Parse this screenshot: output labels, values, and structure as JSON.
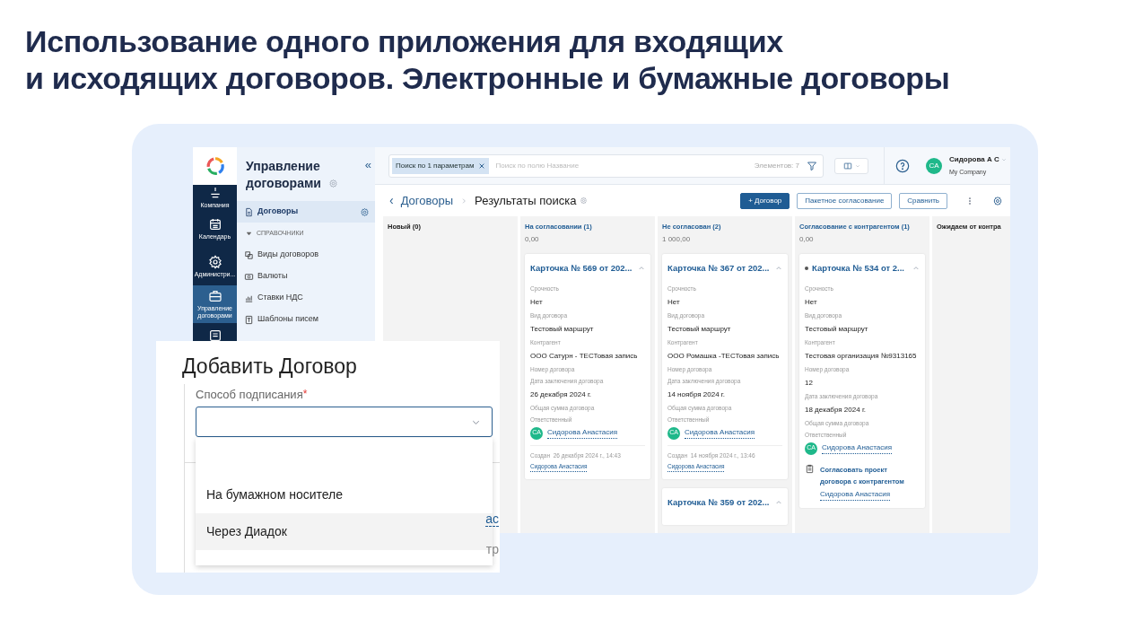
{
  "heading": [
    "Использование одного приложения для входящих",
    "и исходящих договоров. Электронные и бумажные договоры"
  ],
  "app": {
    "rail": [
      {
        "kind": "company",
        "label": "Компания",
        "selected": false
      },
      {
        "kind": "calendar",
        "label": "Календарь",
        "selected": false
      },
      {
        "kind": "admin",
        "label": "Администри...",
        "selected": false
      },
      {
        "kind": "contracts",
        "label": "Управление договорами",
        "selected": true
      },
      {
        "kind": "list",
        "selected": false
      }
    ],
    "sidebar": {
      "title": "Управление договорами",
      "items": [
        {
          "kind": "link",
          "label": "Договоры",
          "selected": true
        },
        {
          "kind": "section",
          "label": "СПРАВОЧНИКИ",
          "expanded": true,
          "children": [
            {
              "kind": "link",
              "label": "Виды договоров",
              "selected": false
            },
            {
              "kind": "link",
              "label": "Валюты",
              "selected": false
            },
            {
              "kind": "link",
              "label": "Ставки НДС",
              "selected": false
            },
            {
              "kind": "link",
              "label": "Шаблоны писем",
              "selected": false
            }
          ]
        }
      ],
      "collapse": "«"
    },
    "search": {
      "chip": "Поиск по 1 параметрам",
      "placeholder": "Поиск по полю Название",
      "count": "Элементов: 7"
    },
    "user": {
      "initials": "CA",
      "name": "Сидорова А С",
      "company": "My Company"
    },
    "back": "‹",
    "breadcrumb": [
      "Договоры",
      "Результаты поиска"
    ],
    "buttons": [
      {
        "kind": "primary",
        "label": "+ Договор"
      },
      {
        "kind": "outline",
        "label": "Пакетное согласование"
      },
      {
        "kind": "outline",
        "label": "Сравнить"
      }
    ],
    "columns": [
      {
        "title": "Новый (0)"
      },
      {
        "title": "На согласовании (1)",
        "sum": "0,00",
        "cards": [
          {
            "title": "Карточка № 569 от 202...",
            "dot": false,
            "fields": [
              {
                "label": "Срочность",
                "value": "Нет"
              },
              {
                "label": "Вид договора",
                "value": "Тестовый маршрут"
              },
              {
                "label": "Контрагент",
                "value": "ООО Сатурн - ТЕСТовая запись"
              },
              {
                "label": "Номер договора"
              },
              {
                "label": "Дата заключения договора",
                "value": "26 декабря 2024 г."
              },
              {
                "label": "Общая сумма договора"
              }
            ],
            "responsible_label": "Ответственный",
            "responsible": {
              "initials": "CA",
              "name": "Сидорова Анастасия"
            },
            "created": {
              "text": "Создан  26 декабря 2024 г., 14:43",
              "author": "Сидорова Анастасия"
            }
          }
        ]
      },
      {
        "title": "Не согласован (2)",
        "sum": "1 000,00",
        "cards": [
          {
            "title": "Карточка № 367 от 202...",
            "dot": false,
            "fields": [
              {
                "label": "Срочность",
                "value": "Нет"
              },
              {
                "label": "Вид договора",
                "value": "Тестовый маршрут"
              },
              {
                "label": "Контрагент",
                "value": "ООО Ромашка -ТЕСТовая запись"
              },
              {
                "label": "Номер договора"
              },
              {
                "label": "Дата заключения договора",
                "value": "14 ноября 2024 г."
              },
              {
                "label": "Общая сумма договора"
              }
            ],
            "responsible_label": "Ответственный",
            "responsible": {
              "initials": "CA",
              "name": "Сидорова Анастасия"
            },
            "created": {
              "text": "Создан  14 ноября 2024 г., 13:46",
              "author": "Сидорова Анастасия"
            }
          },
          {
            "title": "Карточка № 359 от 202...",
            "dot": false
          }
        ]
      },
      {
        "title": "Согласование с контрагентом (1)",
        "sum": "0,00",
        "cards": [
          {
            "title": "Карточка № 534 от 2...",
            "dot": true,
            "fields": [
              {
                "label": "Срочность",
                "value": "Нет"
              },
              {
                "label": "Вид договора",
                "value": "Тестовый маршрут"
              },
              {
                "label": "Контрагент",
                "value": "Тестовая организация №9313165"
              },
              {
                "label": "Номер договора",
                "value": "12"
              },
              {
                "label": "Дата заключения договора",
                "value": "18 декабря 2024 г."
              },
              {
                "label": "Общая сумма договора"
              }
            ],
            "responsible_label": "Ответственный",
            "responsible": {
              "initials": "CA",
              "name": "Сидорова Анастасия"
            },
            "task": {
              "text": "Согласовать проект договора с контрагентом",
              "author": "Сидорова Анастасия"
            }
          }
        ]
      },
      {
        "title": "Ожидаем от контра"
      }
    ]
  },
  "dialog": {
    "title": "Добавить Договор",
    "field_label": "Способ подписания",
    "required_mark": "*",
    "options": [
      {
        "label": "На бумажном носителе",
        "selected": false
      },
      {
        "label": "Через Диадок",
        "selected": true
      }
    ],
    "fragments": [
      {
        "kind": "link",
        "text": "ас"
      },
      {
        "kind": "plain",
        "text": "тр"
      }
    ]
  }
}
